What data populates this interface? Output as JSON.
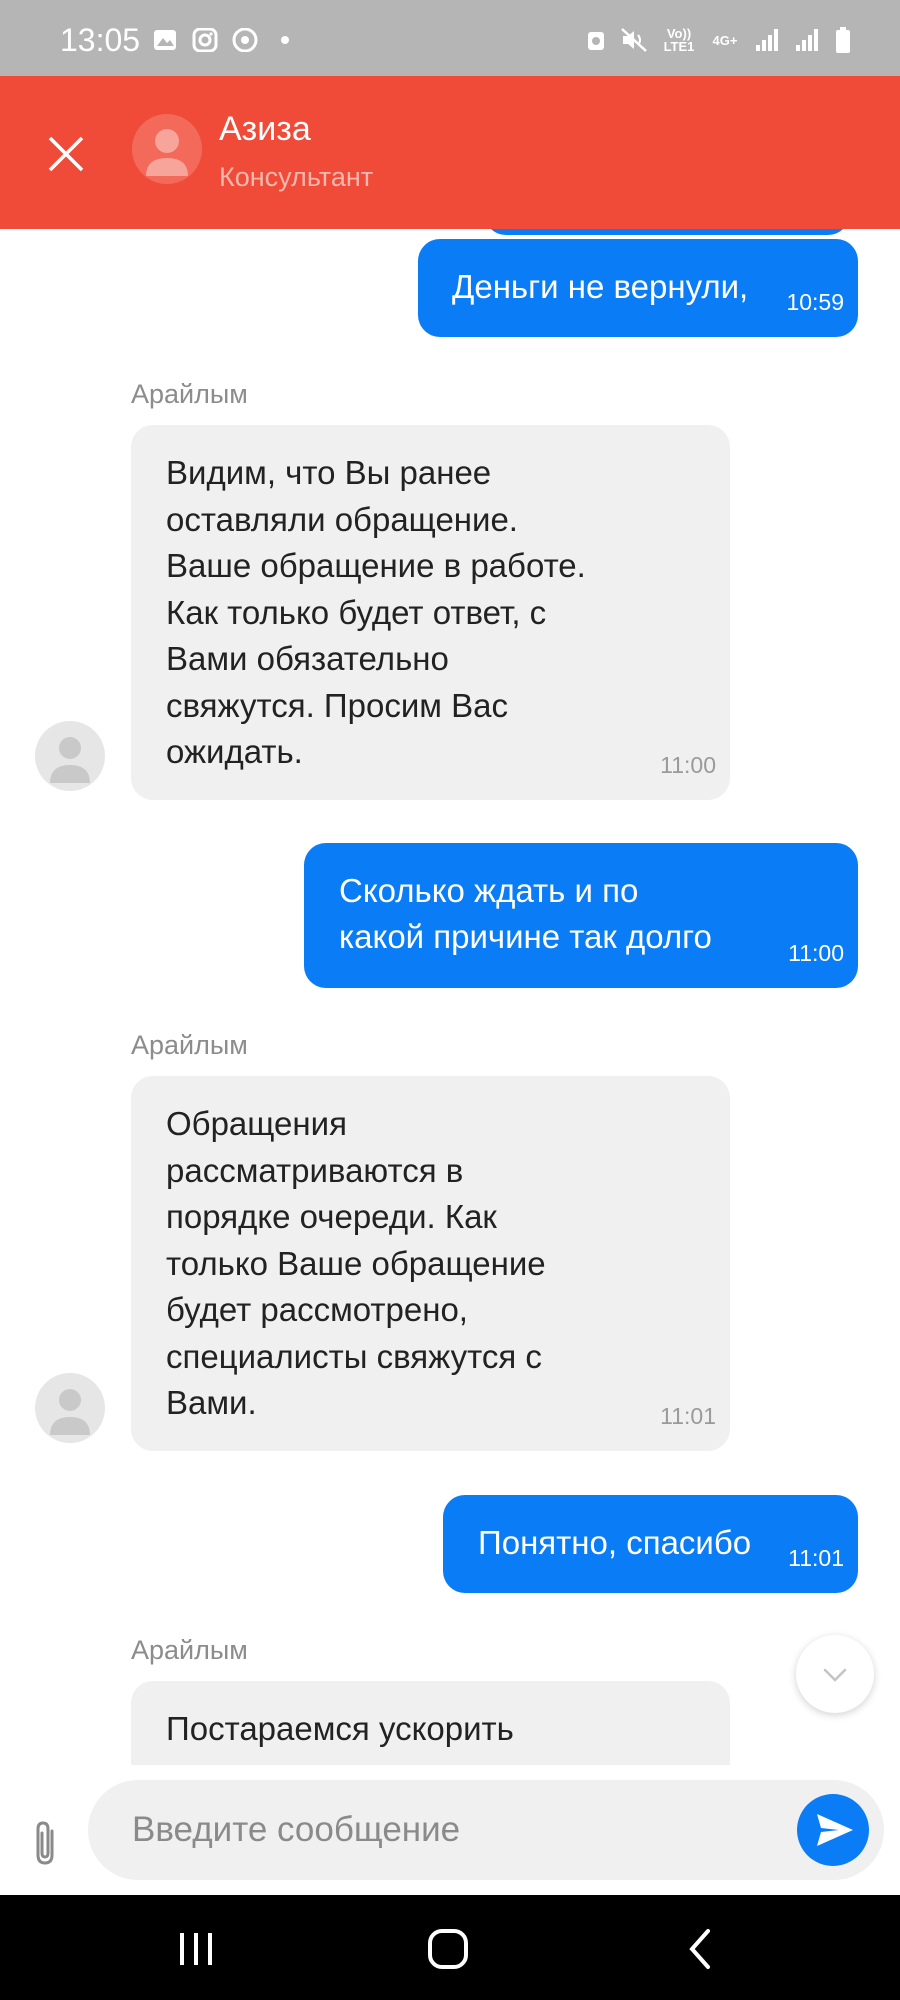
{
  "status_bar": {
    "time": "13:05",
    "left_icons": [
      "gallery-icon",
      "instagram-icon",
      "chrome-icon",
      "dot-icon"
    ],
    "right_icons": [
      "alarm-icon",
      "mute-icon",
      "volte-icon",
      "4g-icon",
      "signal-icon",
      "signal-icon",
      "battery-icon"
    ],
    "volte_label": "Vo)) LTE1",
    "net_label": "4G+"
  },
  "header": {
    "name": "Азиза",
    "role": "Консультант",
    "close_icon": "close-icon",
    "avatar_icon": "person-icon"
  },
  "colors": {
    "header": "#f04b38",
    "outgoing_bubble": "#0a7cf5",
    "incoming_bubble": "#f0f0f0",
    "timestamp_in": "#9a9a9a"
  },
  "messages": [
    {
      "direction": "out",
      "text": "Деньги не вернули,",
      "time": "10:59"
    },
    {
      "direction": "in",
      "sender": "Арайлым",
      "lines": [
        "Видим, что Вы ранее",
        "оставляли обращение.",
        "Ваше обращение в работе.",
        "Как только будет ответ, с",
        "Вами обязательно",
        "свяжутся. Просим Вас",
        "ожидать."
      ],
      "time": "11:00"
    },
    {
      "direction": "out",
      "lines": [
        "Сколько ждать и по",
        "какой причине так долго"
      ],
      "time": "11:00"
    },
    {
      "direction": "in",
      "sender": "Арайлым",
      "lines": [
        "Обращения",
        "рассматриваются в",
        "порядке очереди. Как",
        "только Ваше обращение",
        "будет рассмотрено,",
        "специалисты свяжутся с",
        "Вами."
      ],
      "time": "11:01"
    },
    {
      "direction": "out",
      "text": "Понятно, спасибо",
      "time": "11:01"
    },
    {
      "direction": "in",
      "sender": "Арайлым",
      "lines": [
        "Постараемся ускорить"
      ]
    }
  ],
  "input": {
    "placeholder": "Введите сообщение",
    "attach_icon": "paperclip-icon",
    "send_icon": "send-icon"
  },
  "scroll_button_icon": "chevron-down-icon",
  "nav_bar": [
    "recent-apps-icon",
    "home-icon",
    "back-icon"
  ]
}
